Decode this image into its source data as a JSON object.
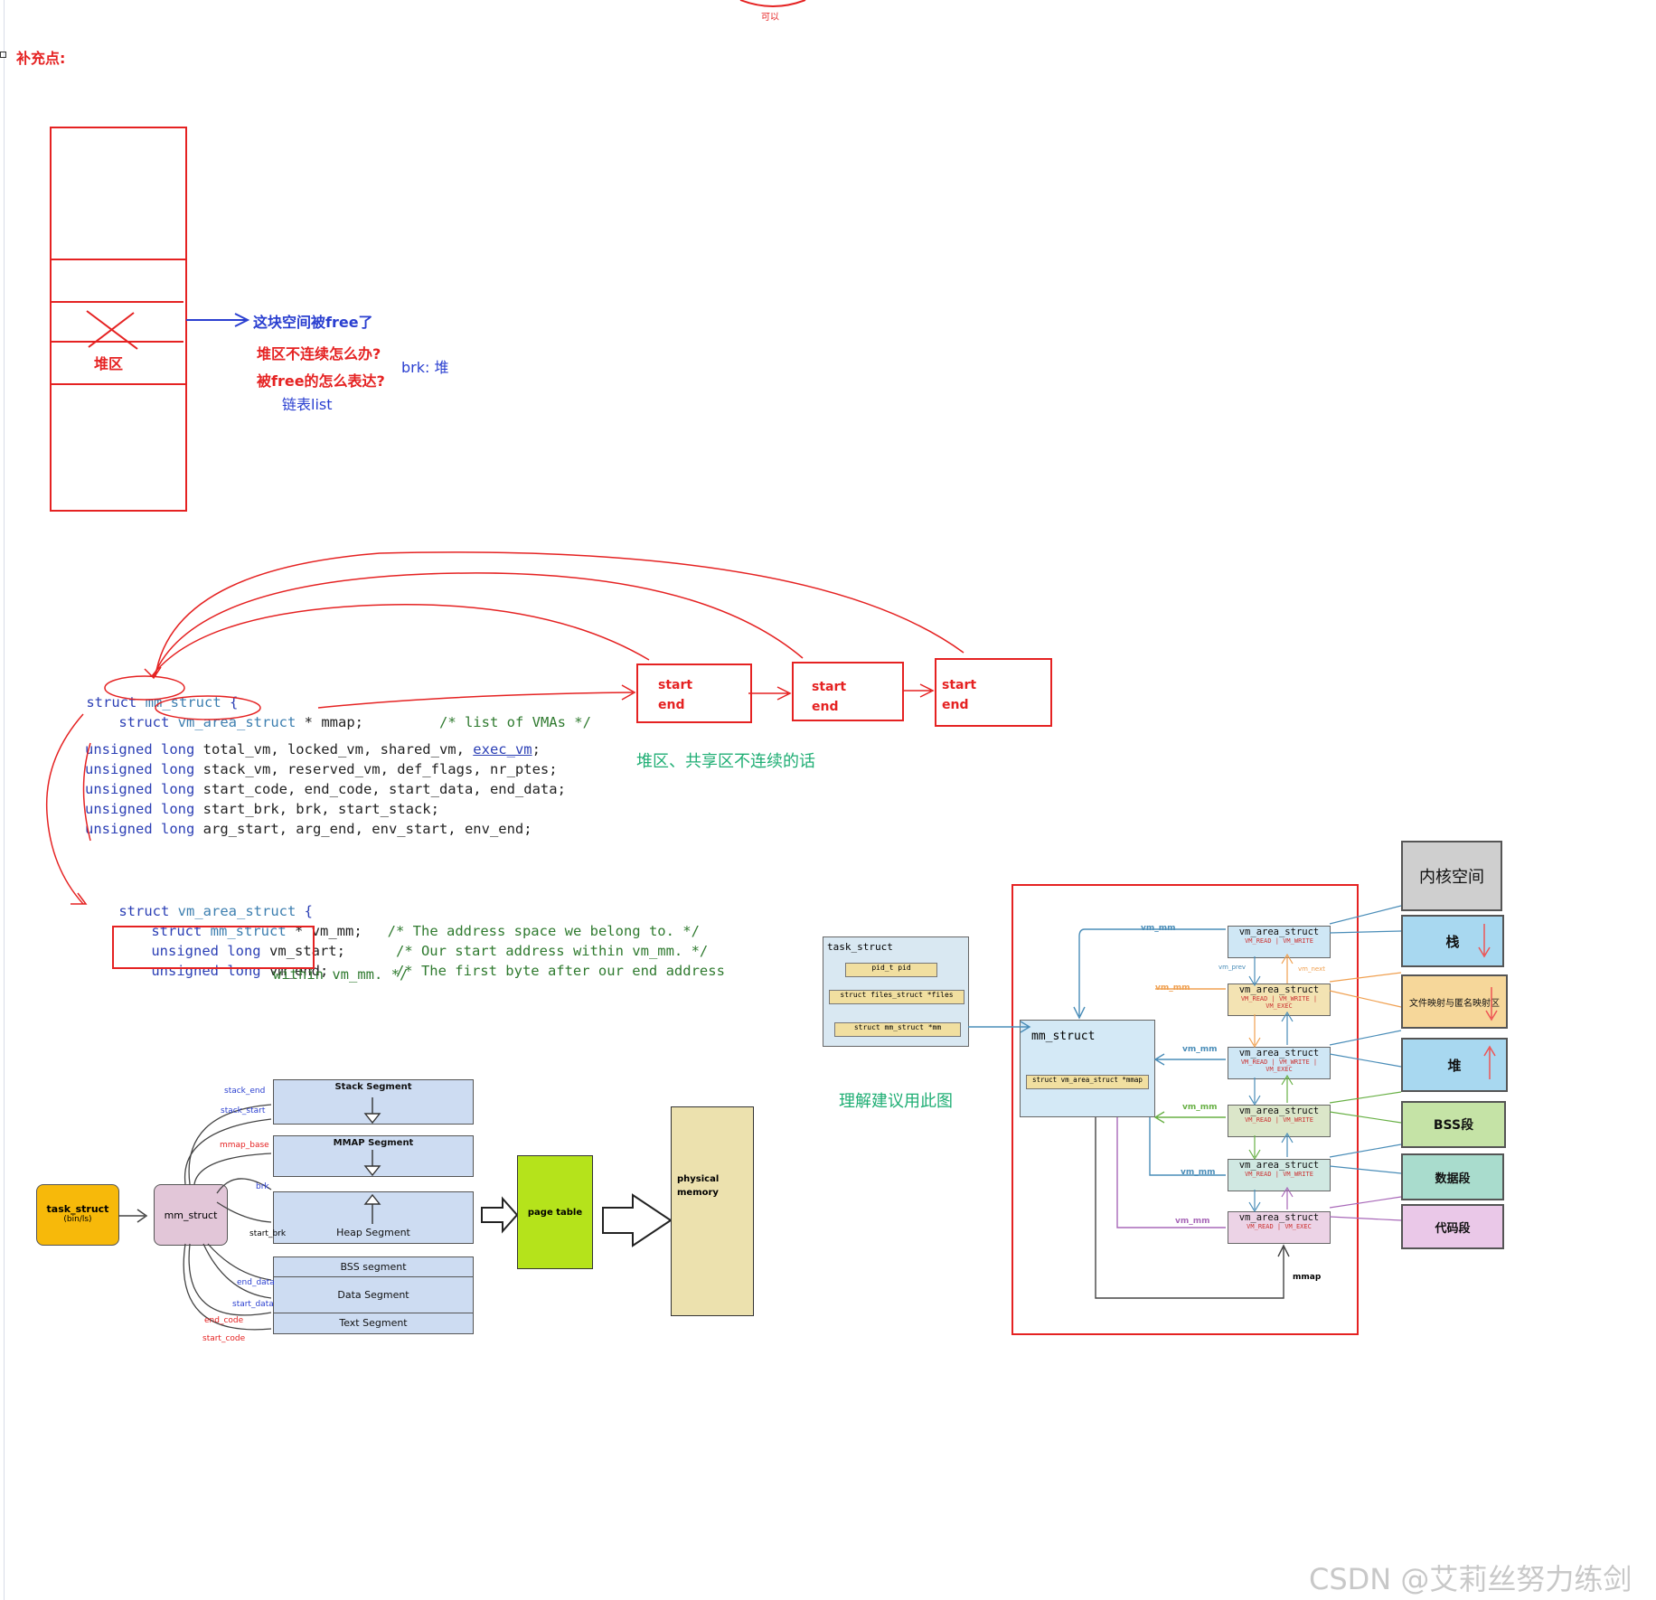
{
  "top_label": "可以",
  "supplement_title": "补充点:",
  "heap_diagram": {
    "heap_label": "堆区",
    "freed_note": "这块空间被free了",
    "question1": "堆区不连续怎么办?",
    "question2": "被free的怎么表达?",
    "brk_note": "brk: 堆",
    "list_note": "链表list"
  },
  "code": {
    "mm_struct_line": [
      "struct",
      "mm_struct",
      " {"
    ],
    "mmap_line": [
      "struct",
      "vm_area_struct",
      " * mmap;",
      "/* list of VMAs */"
    ],
    "fields": [
      [
        "unsigned long",
        " total_vm, locked_vm, shared_vm, ",
        "exec_vm",
        ";"
      ],
      [
        "unsigned long",
        " stack_vm, reserved_vm, def_flags, nr_ptes;",
        "",
        ""
      ],
      [
        "unsigned long",
        " start_code, end_code, start_data, end_data;",
        "",
        ""
      ],
      [
        "unsigned long",
        " start_brk, brk, start_stack;",
        "",
        ""
      ],
      [
        "unsigned long",
        " arg_start, arg_end, env_start, env_end;",
        "",
        ""
      ]
    ],
    "vma_line": [
      "struct",
      "vm_area_struct",
      " {"
    ],
    "vm_mm_line": [
      "struct",
      "mm_struct",
      " * vm_mm;",
      "/* The address space we belong to. */"
    ],
    "vm_start_line": [
      "unsigned long",
      " vm_start;",
      "/* Our start address within vm_mm. */"
    ],
    "vm_end_line": [
      "unsigned long",
      " vm_end;",
      "/* The first byte after our end address"
    ],
    "vm_end_cont": "within vm_mm. */"
  },
  "chain_boxes": [
    {
      "start": "start",
      "end": "end"
    },
    {
      "start": "start",
      "end": "end"
    },
    {
      "start": "start",
      "end": "end"
    }
  ],
  "chain_note": "堆区、共享区不连续的话",
  "seg_diagram": {
    "task_struct": "task_struct",
    "task_struct_sub": "(bin/ls)",
    "mm_struct": "mm_struct",
    "segments": [
      "Stack Segment",
      "MMAP Segment",
      "Heap Segment",
      "BSS segment",
      "Data Segment",
      "Text Segment"
    ],
    "pointers": [
      "stack_end",
      "stack_start",
      "mmap_base",
      "brk",
      "start_brk",
      "end_data",
      "start_data",
      "end_code",
      "start_code"
    ],
    "page_table": "page table",
    "physical_memory": [
      "physical",
      "memory"
    ]
  },
  "vma_diagram": {
    "task_struct": "task_struct",
    "fields": [
      "pid_t  pid",
      "struct files_struct *files",
      "struct mm_struct    *mm"
    ],
    "mm_struct": "mm_struct",
    "mmap_field": "struct vm_area_struct *mmap",
    "vm_area": "vm_area_struct",
    "vm_mm": "vm_mm",
    "vm_prev": "vm_prev",
    "vm_next": "vm_next",
    "mmap": "mmap",
    "flags": [
      "VM_READ | VM_WRITE",
      "VM_READ | VM_WRITE | VM_EXEC",
      "VM_READ | VM_WRITE | VM_EXEC",
      "VM_READ | VM_WRITE",
      "VM_READ | VM_WRITE",
      "VM_READ | VM_EXEC"
    ],
    "regions": [
      "内核空间",
      "栈",
      "文件映射与匿名映射区",
      "堆",
      "BSS段",
      "数据段",
      "代码段"
    ],
    "suggest": "理解建议用此图"
  },
  "watermark": "CSDN @艾莉丝努力练剑"
}
